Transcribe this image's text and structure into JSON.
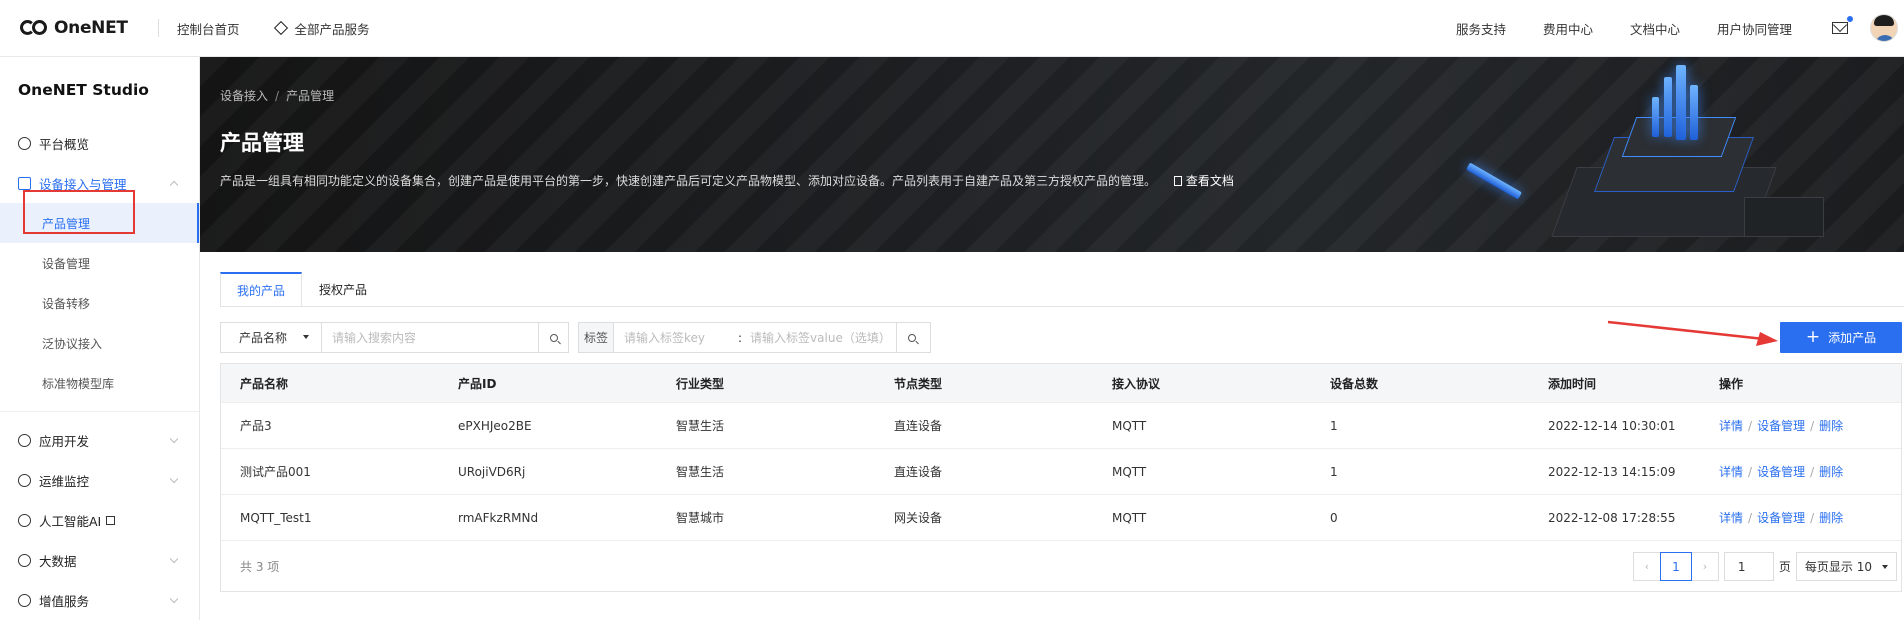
{
  "topbar": {
    "logo_text": "OneNET",
    "console_home": "控制台首页",
    "all_products": "全部产品服务",
    "right_links": [
      "服务支持",
      "费用中心",
      "文档中心",
      "用户协同管理"
    ]
  },
  "sidebar": {
    "title": "OneNET Studio",
    "overview": "平台概览",
    "device_access": "设备接入与管理",
    "sub_items": [
      "产品管理",
      "设备管理",
      "设备转移",
      "泛协议接入",
      "标准物模型库"
    ],
    "app_dev": "应用开发",
    "ops_monitor": "运维监控",
    "ai": "人工智能AI",
    "big_data": "大数据",
    "value_added": "增值服务"
  },
  "banner": {
    "crumb_parent": "设备接入",
    "crumb_current": "产品管理",
    "title": "产品管理",
    "description": "产品是一组具有相同功能定义的设备集合，创建产品是使用平台的第一步，快速创建产品后可定义产品物模型、添加对应设备。产品列表用于自建产品及第三方授权产品的管理。",
    "doc_link": "查看文档"
  },
  "tabs": [
    "我的产品",
    "授权产品"
  ],
  "filters": {
    "field_select": "产品名称",
    "search_placeholder": "请输入搜索内容",
    "tag_label": "标签",
    "tag_key_placeholder": "请输入标签key",
    "tag_value_placeholder": "请输入标签value（选填）"
  },
  "add_button": "添加产品",
  "table": {
    "headers": [
      "产品名称",
      "产品ID",
      "行业类型",
      "节点类型",
      "接入协议",
      "设备总数",
      "添加时间",
      "操作"
    ],
    "rows": [
      [
        "产品3",
        "ePXHJeo2BE",
        "智慧生活",
        "直连设备",
        "MQTT",
        "1",
        "2022-12-14 10:30:01"
      ],
      [
        "测试产品001",
        "URojiVD6Rj",
        "智慧生活",
        "直连设备",
        "MQTT",
        "1",
        "2022-12-13 14:15:09"
      ],
      [
        "MQTT_Test1",
        "rmAFkzRMNd",
        "智慧城市",
        "网关设备",
        "MQTT",
        "0",
        "2022-12-08 17:28:55"
      ]
    ],
    "actions": [
      "详情",
      "设备管理",
      "删除"
    ],
    "total": "共 3 项"
  },
  "pager": {
    "current": "1",
    "jump_value": "1",
    "unit": "页",
    "page_size": "每页显示 10"
  },
  "colors": {
    "accent": "#2a6ff0",
    "annotation_red": "#e53935"
  }
}
